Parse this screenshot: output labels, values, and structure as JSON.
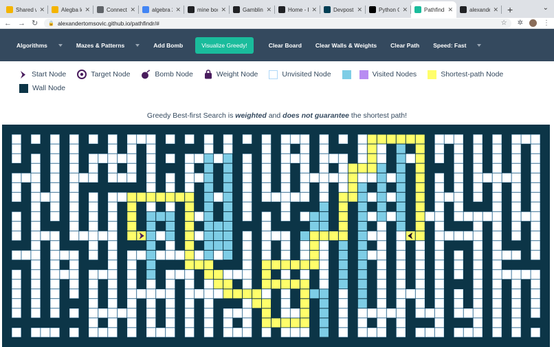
{
  "browser": {
    "tabs": [
      {
        "label": "Shared w",
        "color": "#f4b400"
      },
      {
        "label": "Alegba lo",
        "color": "#f4b400"
      },
      {
        "label": "Connecti",
        "color": "#5f6368"
      },
      {
        "label": "algebra 2",
        "color": "#4285f4"
      },
      {
        "label": "mine boo",
        "color": "#202124"
      },
      {
        "label": "Gambling",
        "color": "#202124"
      },
      {
        "label": "Home - R",
        "color": "#202124"
      },
      {
        "label": "Devpost",
        "color": "#003e54"
      },
      {
        "label": "Python C",
        "color": "#000000"
      },
      {
        "label": "Pathfindr",
        "color": "#1abc9c",
        "active": true
      },
      {
        "label": "alexander",
        "color": "#202124"
      }
    ],
    "new_tab": "+",
    "url": "alexandertomsovic.github.io/pathfindr/#"
  },
  "navbar": {
    "algorithms": "Algorithms",
    "mazes": "Mazes & Patterns",
    "add_bomb": "Add Bomb",
    "visualize": "Visualize Greedy!",
    "clear_board": "Clear Board",
    "clear_walls": "Clear Walls & Weights",
    "clear_path": "Clear Path",
    "speed": "Speed: Fast"
  },
  "legend": {
    "start": "Start Node",
    "target": "Target Node",
    "bomb": "Bomb Node",
    "weight": "Weight Node",
    "unvisited": "Unvisited Node",
    "visited": "Visited Nodes",
    "shortest": "Shortest-path Node",
    "wall": "Wall Node"
  },
  "description": {
    "pre": "Greedy Best-first Search is ",
    "em1": "weighted",
    "mid": " and ",
    "em2": "does not guarantee",
    "post": " the shortest path!"
  },
  "colors": {
    "wall": "#0c3547",
    "visited": "#7ecde6",
    "path": "#fffe6a",
    "unvisited_border": "#afd8f8",
    "navbar": "#34495e",
    "accent": "#1abc9c",
    "node_icon": "#4a1d5e"
  },
  "grid": {
    "cols": 57,
    "rows": 23,
    "start": [
      14,
      11
    ],
    "target": [
      42,
      11
    ],
    "path": [
      [
        14,
        11
      ],
      [
        13,
        11
      ],
      [
        13,
        10
      ],
      [
        13,
        9
      ],
      [
        13,
        8
      ],
      [
        13,
        7
      ],
      [
        14,
        7
      ],
      [
        15,
        7
      ],
      [
        16,
        7
      ],
      [
        17,
        7
      ],
      [
        18,
        7
      ],
      [
        19,
        7
      ],
      [
        19,
        8
      ],
      [
        19,
        9
      ],
      [
        19,
        10
      ],
      [
        19,
        11
      ],
      [
        19,
        12
      ],
      [
        19,
        13
      ],
      [
        19,
        14
      ],
      [
        20,
        14
      ],
      [
        21,
        14
      ],
      [
        21,
        15
      ],
      [
        22,
        15
      ],
      [
        22,
        16
      ],
      [
        23,
        16
      ],
      [
        23,
        17
      ],
      [
        24,
        17
      ],
      [
        25,
        17
      ],
      [
        26,
        17
      ],
      [
        26,
        18
      ],
      [
        27,
        18
      ],
      [
        27,
        19
      ],
      [
        27,
        20
      ],
      [
        28,
        20
      ],
      [
        29,
        20
      ],
      [
        30,
        20
      ],
      [
        31,
        20
      ],
      [
        31,
        19
      ],
      [
        31,
        18
      ],
      [
        31,
        17
      ],
      [
        31,
        16
      ],
      [
        30,
        16
      ],
      [
        29,
        16
      ],
      [
        28,
        16
      ],
      [
        27,
        16
      ],
      [
        27,
        15
      ],
      [
        27,
        14
      ],
      [
        28,
        14
      ],
      [
        29,
        14
      ],
      [
        30,
        14
      ],
      [
        31,
        14
      ],
      [
        32,
        14
      ],
      [
        32,
        13
      ],
      [
        32,
        12
      ],
      [
        32,
        11
      ],
      [
        33,
        11
      ],
      [
        34,
        11
      ],
      [
        35,
        11
      ],
      [
        35,
        10
      ],
      [
        35,
        9
      ],
      [
        35,
        8
      ],
      [
        35,
        7
      ],
      [
        36,
        7
      ],
      [
        36,
        6
      ],
      [
        36,
        5
      ],
      [
        36,
        4
      ],
      [
        37,
        4
      ],
      [
        38,
        4
      ],
      [
        38,
        3
      ],
      [
        38,
        2
      ],
      [
        38,
        1
      ],
      [
        39,
        1
      ],
      [
        40,
        1
      ],
      [
        41,
        1
      ],
      [
        42,
        1
      ],
      [
        43,
        1
      ],
      [
        43,
        2
      ],
      [
        43,
        3
      ],
      [
        43,
        4
      ],
      [
        43,
        5
      ],
      [
        43,
        6
      ],
      [
        43,
        7
      ],
      [
        43,
        8
      ],
      [
        43,
        9
      ],
      [
        43,
        10
      ],
      [
        43,
        11
      ],
      [
        42,
        11
      ]
    ],
    "visited": [
      [
        15,
        9
      ],
      [
        15,
        10
      ],
      [
        15,
        11
      ],
      [
        15,
        12
      ],
      [
        15,
        13
      ],
      [
        15,
        14
      ],
      [
        15,
        15
      ],
      [
        16,
        9
      ],
      [
        17,
        9
      ],
      [
        17,
        10
      ],
      [
        17,
        11
      ],
      [
        21,
        3
      ],
      [
        21,
        4
      ],
      [
        21,
        5
      ],
      [
        21,
        6
      ],
      [
        21,
        7
      ],
      [
        21,
        8
      ],
      [
        21,
        9
      ],
      [
        21,
        10
      ],
      [
        21,
        11
      ],
      [
        21,
        12
      ],
      [
        21,
        13
      ],
      [
        22,
        10
      ],
      [
        22,
        11
      ],
      [
        22,
        12
      ],
      [
        23,
        3
      ],
      [
        23,
        4
      ],
      [
        23,
        5
      ],
      [
        23,
        6
      ],
      [
        23,
        7
      ],
      [
        23,
        8
      ],
      [
        23,
        9
      ],
      [
        23,
        10
      ],
      [
        23,
        11
      ],
      [
        23,
        12
      ],
      [
        23,
        13
      ],
      [
        31,
        11
      ],
      [
        32,
        9
      ],
      [
        32,
        10
      ],
      [
        33,
        8
      ],
      [
        33,
        9
      ],
      [
        33,
        10
      ],
      [
        35,
        12
      ],
      [
        35,
        13
      ],
      [
        35,
        14
      ],
      [
        35,
        15
      ],
      [
        35,
        16
      ],
      [
        33,
        17
      ],
      [
        33,
        18
      ],
      [
        33,
        19
      ],
      [
        33,
        20
      ],
      [
        33,
        21
      ],
      [
        32,
        17
      ],
      [
        37,
        6
      ],
      [
        37,
        7
      ],
      [
        37,
        8
      ],
      [
        37,
        9
      ],
      [
        37,
        10
      ],
      [
        37,
        11
      ],
      [
        37,
        12
      ],
      [
        37,
        13
      ],
      [
        37,
        14
      ],
      [
        37,
        15
      ],
      [
        37,
        16
      ],
      [
        37,
        17
      ],
      [
        37,
        18
      ],
      [
        39,
        4
      ],
      [
        39,
        5
      ],
      [
        39,
        6
      ],
      [
        39,
        7
      ],
      [
        39,
        8
      ],
      [
        39,
        9
      ],
      [
        41,
        2
      ],
      [
        41,
        3
      ],
      [
        41,
        4
      ],
      [
        41,
        5
      ],
      [
        41,
        6
      ],
      [
        41,
        7
      ],
      [
        41,
        8
      ],
      [
        41,
        9
      ],
      [
        41,
        10
      ]
    ],
    "walls_outer": true
  }
}
